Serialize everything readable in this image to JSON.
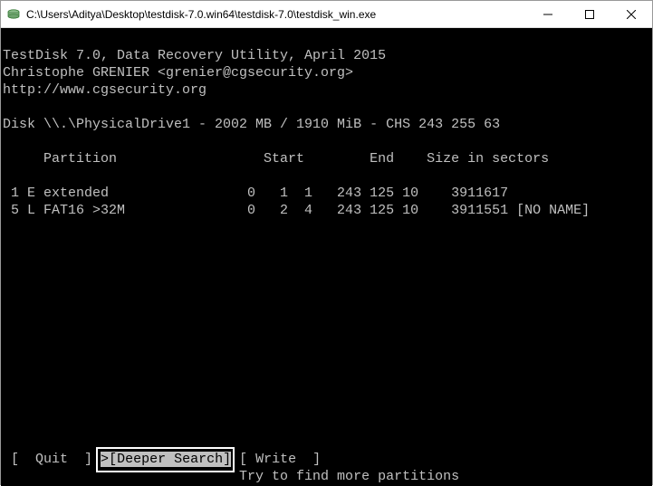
{
  "window": {
    "title": "C:\\Users\\Aditya\\Desktop\\testdisk-7.0.win64\\testdisk-7.0\\testdisk_win.exe"
  },
  "header": {
    "line1": "TestDisk 7.0, Data Recovery Utility, April 2015",
    "line2": "Christophe GRENIER <grenier@cgsecurity.org>",
    "line3": "http://www.cgsecurity.org"
  },
  "disk_line": "Disk \\\\.\\PhysicalDrive1 - 2002 MB / 1910 MiB - CHS 243 255 63",
  "table": {
    "header": "     Partition                  Start        End    Size in sectors",
    "rows": [
      " 1 E extended                 0   1  1   243 125 10    3911617",
      " 5 L FAT16 >32M               0   2  4   243 125 10    3911551 [NO NAME]"
    ]
  },
  "menu": {
    "quit": "[  Quit  ]",
    "deeper_prefix": ">",
    "deeper": "[Deeper Search]",
    "write": "[ Write  ]"
  },
  "menu_desc": "                             Try to find more partitions"
}
